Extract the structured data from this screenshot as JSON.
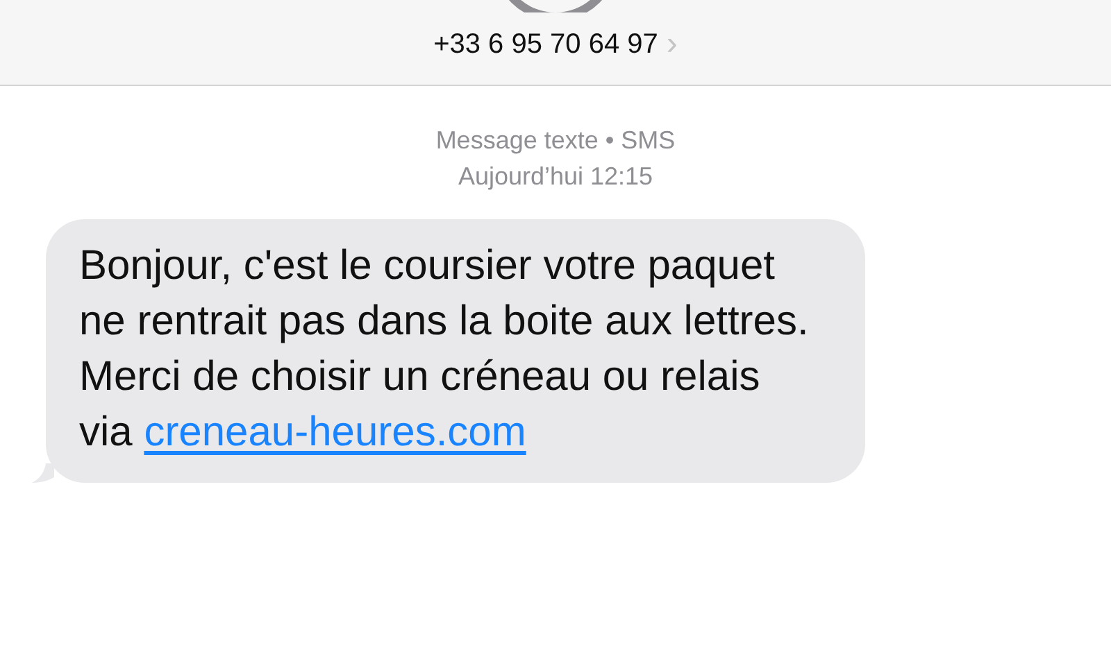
{
  "header": {
    "contact": "+33 6 95 70 64 97",
    "chevron": "›"
  },
  "meta": {
    "service": "Message texte • SMS",
    "time": "Aujourd’hui 12:15"
  },
  "messages": [
    {
      "kind": "received",
      "text": "Bonjour, c'est le coursier votre paquet ne rentrait pas dans la boite aux lettres. Merci de choisir un créneau ou relais via ",
      "link": "creneau-heures.com"
    }
  ]
}
